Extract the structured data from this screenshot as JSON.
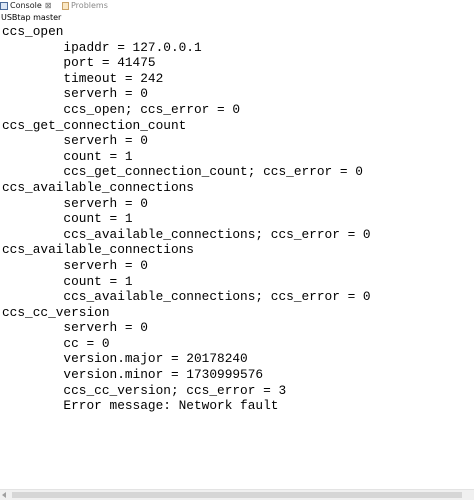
{
  "tabs": [
    {
      "label": "Console",
      "close": "⊠",
      "active": true
    },
    {
      "label": "Problems",
      "active": false
    }
  ],
  "console": {
    "header": "USBtap master",
    "lines": [
      "ccs_open",
      "        ipaddr = 127.0.0.1",
      "        port = 41475",
      "        timeout = 242",
      "        serverh = 0",
      "        ccs_open; ccs_error = 0",
      "ccs_get_connection_count",
      "        serverh = 0",
      "        count = 1",
      "        ccs_get_connection_count; ccs_error = 0",
      "ccs_available_connections",
      "        serverh = 0",
      "        count = 1",
      "        ccs_available_connections; ccs_error = 0",
      "ccs_available_connections",
      "        serverh = 0",
      "        count = 1",
      "        ccs_available_connections; ccs_error = 0",
      "ccs_cc_version",
      "        serverh = 0",
      "        cc = 0",
      "        version.major = 20178240",
      "        version.minor = 1730999576",
      "        ccs_cc_version; ccs_error = 3",
      "        Error message: Network fault"
    ]
  },
  "icons": {
    "console_tab": "console-icon",
    "problems_tab": "problems-icon",
    "scroll_left": "scroll-left-arrow-icon"
  }
}
